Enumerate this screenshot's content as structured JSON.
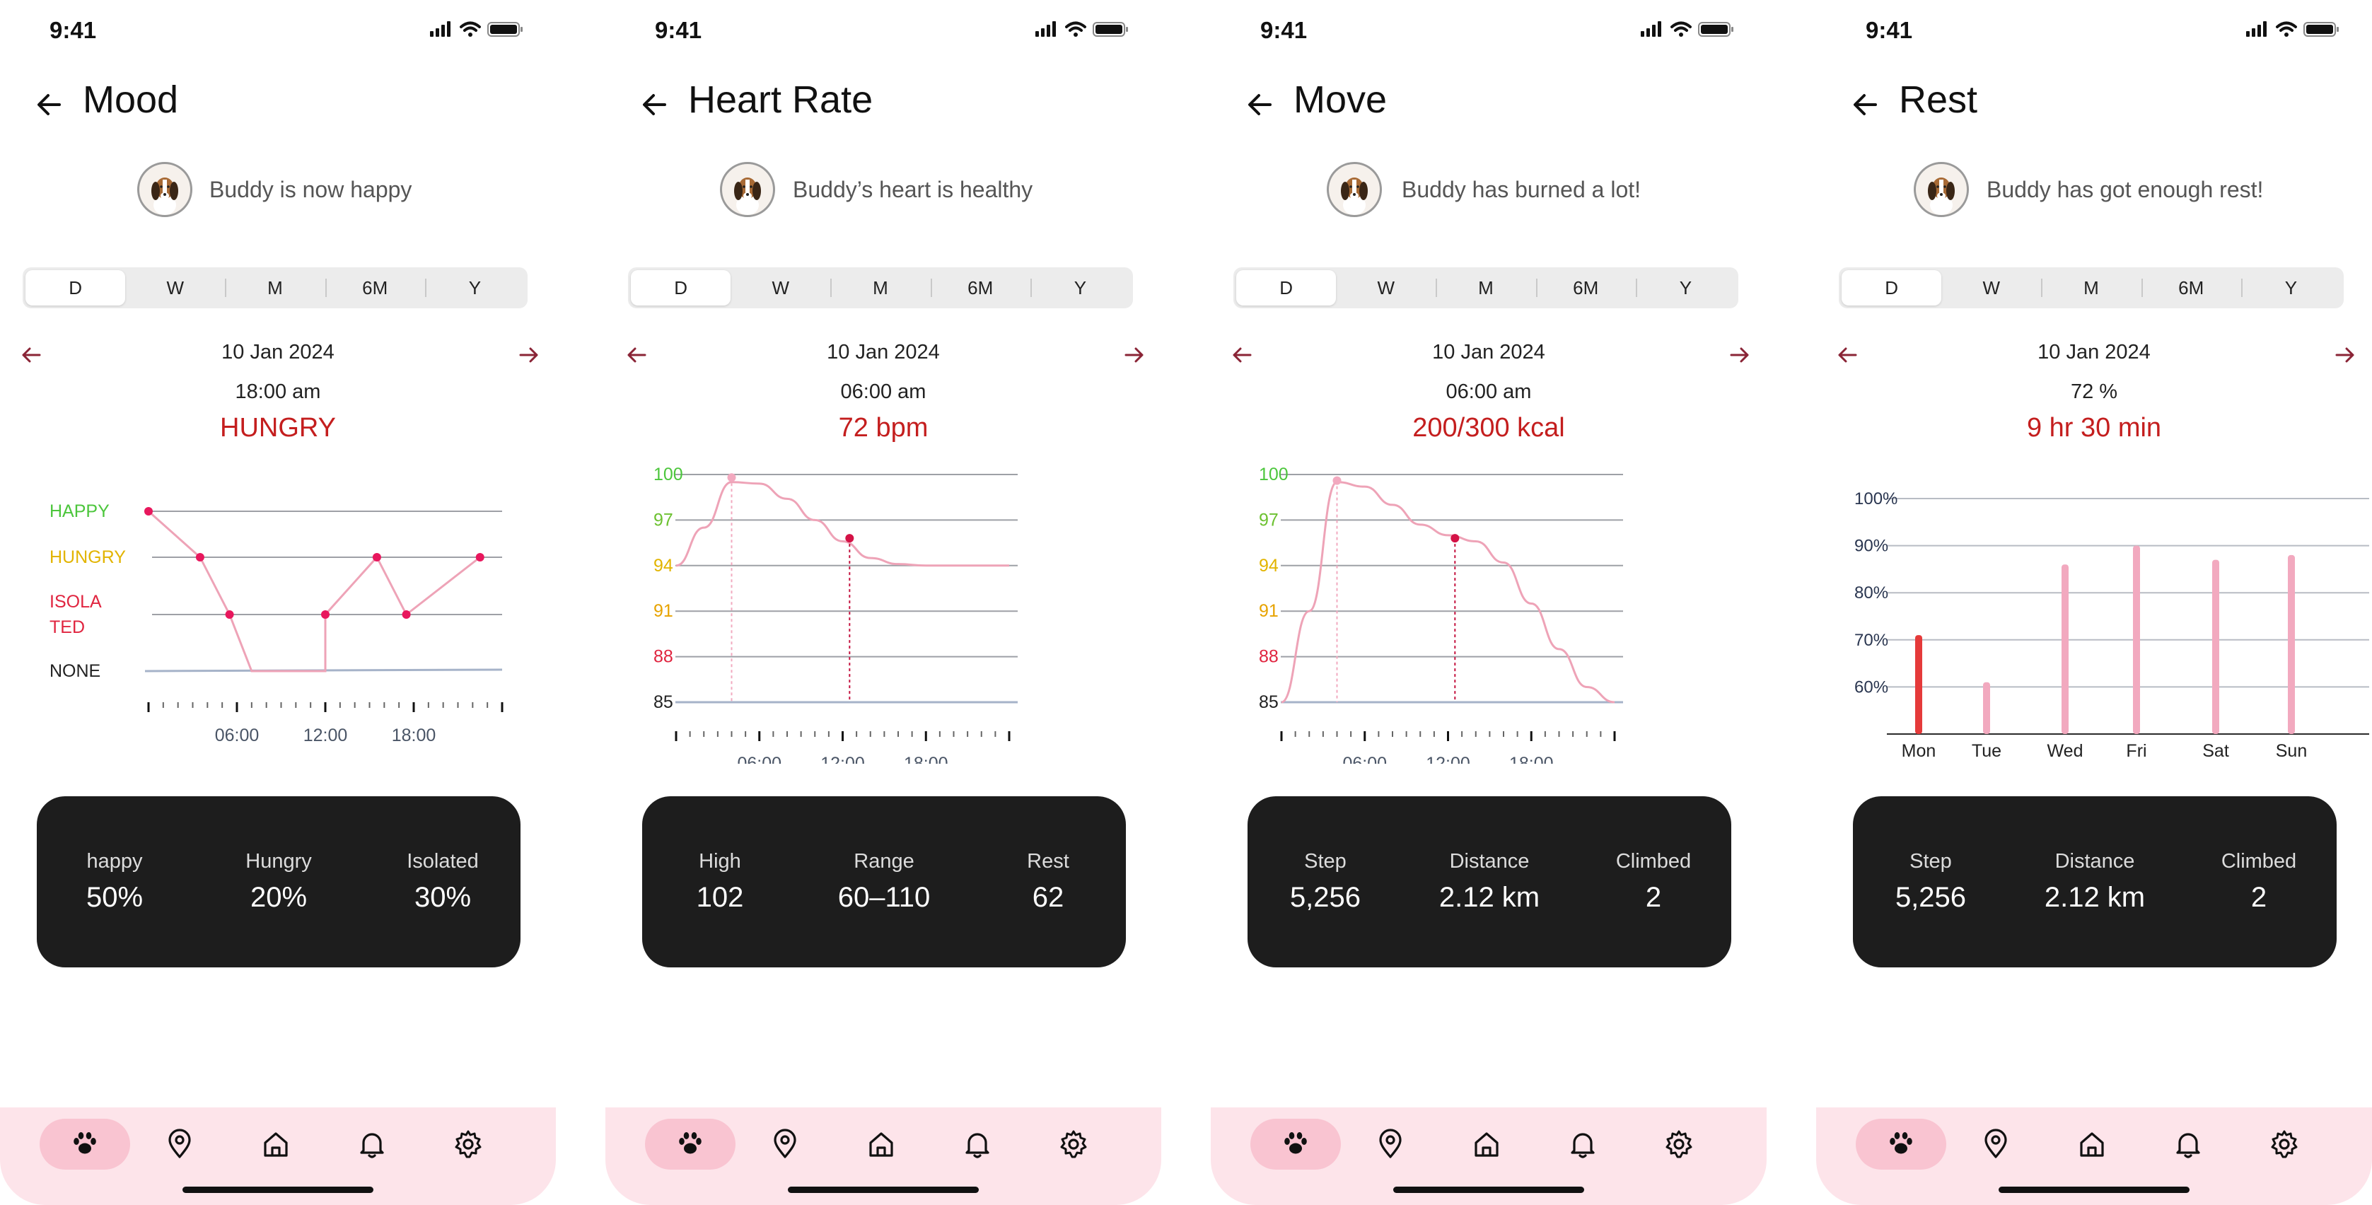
{
  "screens": [
    {
      "status_time": "9:41",
      "title": "Mood",
      "status_message": "Buddy is now happy",
      "tabs": [
        "D",
        "W",
        "M",
        "6M",
        "Y"
      ],
      "active_tab": "D",
      "date": "10 Jan 2024",
      "time": "18:00 am",
      "value": "HUNGRY",
      "stats": [
        {
          "label": "happy",
          "value": "50%"
        },
        {
          "label": "Hungry",
          "value": "20%"
        },
        {
          "label": "Isolated",
          "value": "30%"
        }
      ]
    },
    {
      "status_time": "9:41",
      "title": "Heart Rate",
      "status_message": "Buddy’s heart is healthy",
      "tabs": [
        "D",
        "W",
        "M",
        "6M",
        "Y"
      ],
      "active_tab": "D",
      "date": "10 Jan 2024",
      "time": "06:00 am",
      "value": "72 bpm",
      "stats": [
        {
          "label": "High",
          "value": "102"
        },
        {
          "label": "Range",
          "value": "60–110"
        },
        {
          "label": "Rest",
          "value": "62"
        }
      ]
    },
    {
      "status_time": "9:41",
      "title": "Move",
      "status_message": "Buddy has burned a lot!",
      "tabs": [
        "D",
        "W",
        "M",
        "6M",
        "Y"
      ],
      "active_tab": "D",
      "date": "10 Jan 2024",
      "time": "06:00 am",
      "value": "200/300 kcal",
      "stats": [
        {
          "label": "Step",
          "value": "5,256"
        },
        {
          "label": "Distance",
          "value": "2.12 km"
        },
        {
          "label": "Climbed",
          "value": "2"
        }
      ]
    },
    {
      "status_time": "9:41",
      "title": "Rest",
      "status_message": "Buddy has got enough rest!",
      "tabs": [
        "D",
        "W",
        "M",
        "6M",
        "Y"
      ],
      "active_tab": "D",
      "date": "10 Jan 2024",
      "time": "72 %",
      "value": "9 hr 30 min",
      "stats": [
        {
          "label": "Step",
          "value": "5,256"
        },
        {
          "label": "Distance",
          "value": "2.12 km"
        },
        {
          "label": "Climbed",
          "value": "2"
        }
      ]
    }
  ],
  "bottom_nav": [
    "paw-icon",
    "location-pin-icon",
    "home-icon",
    "bell-icon",
    "gear-icon"
  ],
  "colors": {
    "accent_red": "#c41e1e",
    "chart_pink": "#eea3b7",
    "card_dark": "#1d1d1d",
    "nav_bg": "#fde4ea",
    "nav_active": "#f9c4d1",
    "happy_green": "#4cc63c",
    "hungry_yellow": "#e2b400",
    "isolated_red": "#e0243f"
  },
  "chart_data": [
    {
      "type": "line",
      "title": "",
      "y_categories": [
        "NONE",
        "ISOLA TED",
        "HUNGRY",
        "HAPPY"
      ],
      "x_ticks": [
        "06:00",
        "12:00",
        "18:00"
      ],
      "points": [
        {
          "x": "00:00",
          "y": "HAPPY"
        },
        {
          "x": "03:30",
          "y": "HUNGRY"
        },
        {
          "x": "05:30",
          "y": "ISOLA TED"
        },
        {
          "x": "07:00",
          "y": "NONE"
        },
        {
          "x": "12:00",
          "y": "NONE"
        },
        {
          "x": "12:00",
          "y": "ISOLA TED"
        },
        {
          "x": "15:30",
          "y": "HUNGRY"
        },
        {
          "x": "17:30",
          "y": "ISOLA TED"
        },
        {
          "x": "22:30",
          "y": "HUNGRY"
        }
      ]
    },
    {
      "type": "line",
      "title": "",
      "y_ticks": [
        85,
        88,
        91,
        94,
        97,
        100
      ],
      "ylim": [
        85,
        100
      ],
      "x_ticks": [
        "06:00",
        "12:00",
        "18:00"
      ],
      "x": [
        "00:00",
        "02:00",
        "04:00",
        "06:00",
        "08:00",
        "10:00",
        "12:00",
        "14:00",
        "16:00",
        "18:00",
        "20:00",
        "22:00",
        "24:00"
      ],
      "values": [
        94.0,
        96.5,
        99.5,
        99.4,
        98.4,
        97.0,
        95.6,
        94.5,
        94.1,
        94.0,
        94.0,
        94.0,
        94.0
      ],
      "markers": [
        {
          "x": "04:00",
          "y": 99.8
        },
        {
          "x": "12:30",
          "y": 95.8
        }
      ]
    },
    {
      "type": "area",
      "title": "",
      "y_ticks": [
        85,
        88,
        91,
        94,
        97,
        100
      ],
      "ylim": [
        85,
        100
      ],
      "x_ticks": [
        "06:00",
        "12:00",
        "18:00"
      ],
      "x": [
        "00:00",
        "02:00",
        "04:00",
        "06:00",
        "08:00",
        "10:00",
        "12:00",
        "14:00",
        "16:00",
        "18:00",
        "20:00",
        "22:00",
        "24:00"
      ],
      "values": [
        85,
        91,
        99.5,
        99.2,
        98.0,
        96.7,
        96.0,
        95.6,
        94.2,
        91.5,
        88.5,
        86.0,
        85
      ],
      "markers": [
        {
          "x": "04:00",
          "y": 99.6
        },
        {
          "x": "12:30",
          "y": 95.8
        }
      ]
    },
    {
      "type": "bar",
      "title": "",
      "y_ticks": [
        "60%",
        "70%",
        "80%",
        "90%",
        "100%"
      ],
      "ylim": [
        50,
        100
      ],
      "categories": [
        "Mon",
        "Tue",
        "Wed",
        "Fri",
        "Sat",
        "Sun"
      ],
      "values": [
        71,
        61,
        86,
        90,
        87,
        88
      ],
      "highlight": "Mon"
    }
  ]
}
